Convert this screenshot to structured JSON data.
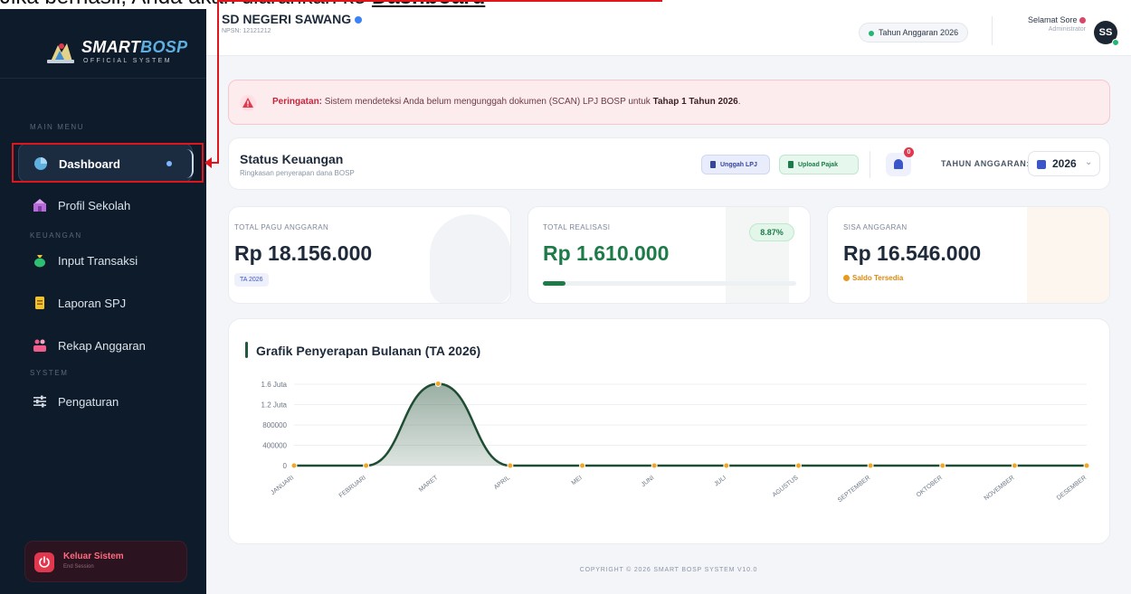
{
  "caption": {
    "prefix": "Jika berhasil, Anda akan diarahkan ke ",
    "emphasis": "Dashboard"
  },
  "sidebar": {
    "brand": {
      "title_a": "SMART",
      "title_b": "BOSP",
      "subtitle": "OFFICIAL SYSTEM"
    },
    "sections": {
      "main": "MAIN MENU",
      "keuangan": "KEUANGAN",
      "system": "SYSTEM"
    },
    "items": [
      {
        "label": "Dashboard",
        "icon": "pie-chart-icon",
        "color": "#5fb0e0"
      },
      {
        "label": "Profil Sekolah",
        "icon": "school-icon",
        "color": "#b86bd8"
      },
      {
        "label": "Input Transaksi",
        "icon": "money-bag-icon",
        "color": "#2fbf71"
      },
      {
        "label": "Laporan SPJ",
        "icon": "document-icon",
        "color": "#f2c12e"
      },
      {
        "label": "Rekap Anggaran",
        "icon": "chart-people-icon",
        "color": "#f05d8a"
      },
      {
        "label": "Pengaturan",
        "icon": "sliders-icon",
        "color": "#cfd6df"
      }
    ],
    "logout": {
      "title": "Keluar Sistem",
      "subtitle": "End Session"
    }
  },
  "topbar": {
    "school_name": "SD NEGERI SAWANG",
    "npsn": "NPSN: 12121212",
    "year_pill": "Tahun Anggaran 2026",
    "greeting": "Selamat Sore",
    "role": "Administrator",
    "avatar_initials": "SS"
  },
  "alert": {
    "label": "Peringatan:",
    "text_before": " Sistem mendeteksi Anda belum mengunggah dokumen (SCAN) LPJ BOSP untuk ",
    "text_bold": "Tahap 1 Tahun 2026",
    "text_after": "."
  },
  "status": {
    "title": "Status Keuangan",
    "subtitle": "Ringkasan penyerapan dana BOSP",
    "btn_lpj": "Unggah LPJ",
    "btn_pajak": "Upload Pajak",
    "notif_count": "0",
    "ta_label": "TAHUN ANGGARAN:",
    "ta_value": "2026"
  },
  "stats": {
    "pagu": {
      "label": "TOTAL PAGU ANGGARAN",
      "value": "Rp 18.156.000",
      "tag": "TA 2026"
    },
    "realisasi": {
      "label": "TOTAL REALISASI",
      "value": "Rp 1.610.000",
      "percent": "8.87%",
      "progress": 0.0887
    },
    "sisa": {
      "label": "SISA ANGGARAN",
      "value": "Rp 16.546.000",
      "note": "Saldo Tersedia"
    }
  },
  "chart": {
    "title": "Grafik Penyerapan Bulanan (TA 2026)"
  },
  "chart_data": {
    "type": "area",
    "title": "Grafik Penyerapan Bulanan (TA 2026)",
    "categories": [
      "JANUARI",
      "FEBRUARI",
      "MARET",
      "APRIL",
      "MEI",
      "JUNI",
      "JULI",
      "AGUSTUS",
      "SEPTEMBER",
      "OKTOBER",
      "NOVEMBER",
      "DESEMBER"
    ],
    "values": [
      0,
      0,
      1610000,
      0,
      0,
      0,
      0,
      0,
      0,
      0,
      0,
      0
    ],
    "y_ticks": [
      0,
      400000,
      800000,
      1200000,
      1600000
    ],
    "y_tick_labels": [
      "0",
      "400000",
      "800000",
      "1.2 Juta",
      "1.6 Juta"
    ],
    "ylim": [
      0,
      1600000
    ],
    "line_color": "#1f4d34",
    "marker_color": "#f2a623",
    "grid": true
  },
  "footer": "COPYRIGHT © 2026 SMART BOSP SYSTEM V10.0"
}
